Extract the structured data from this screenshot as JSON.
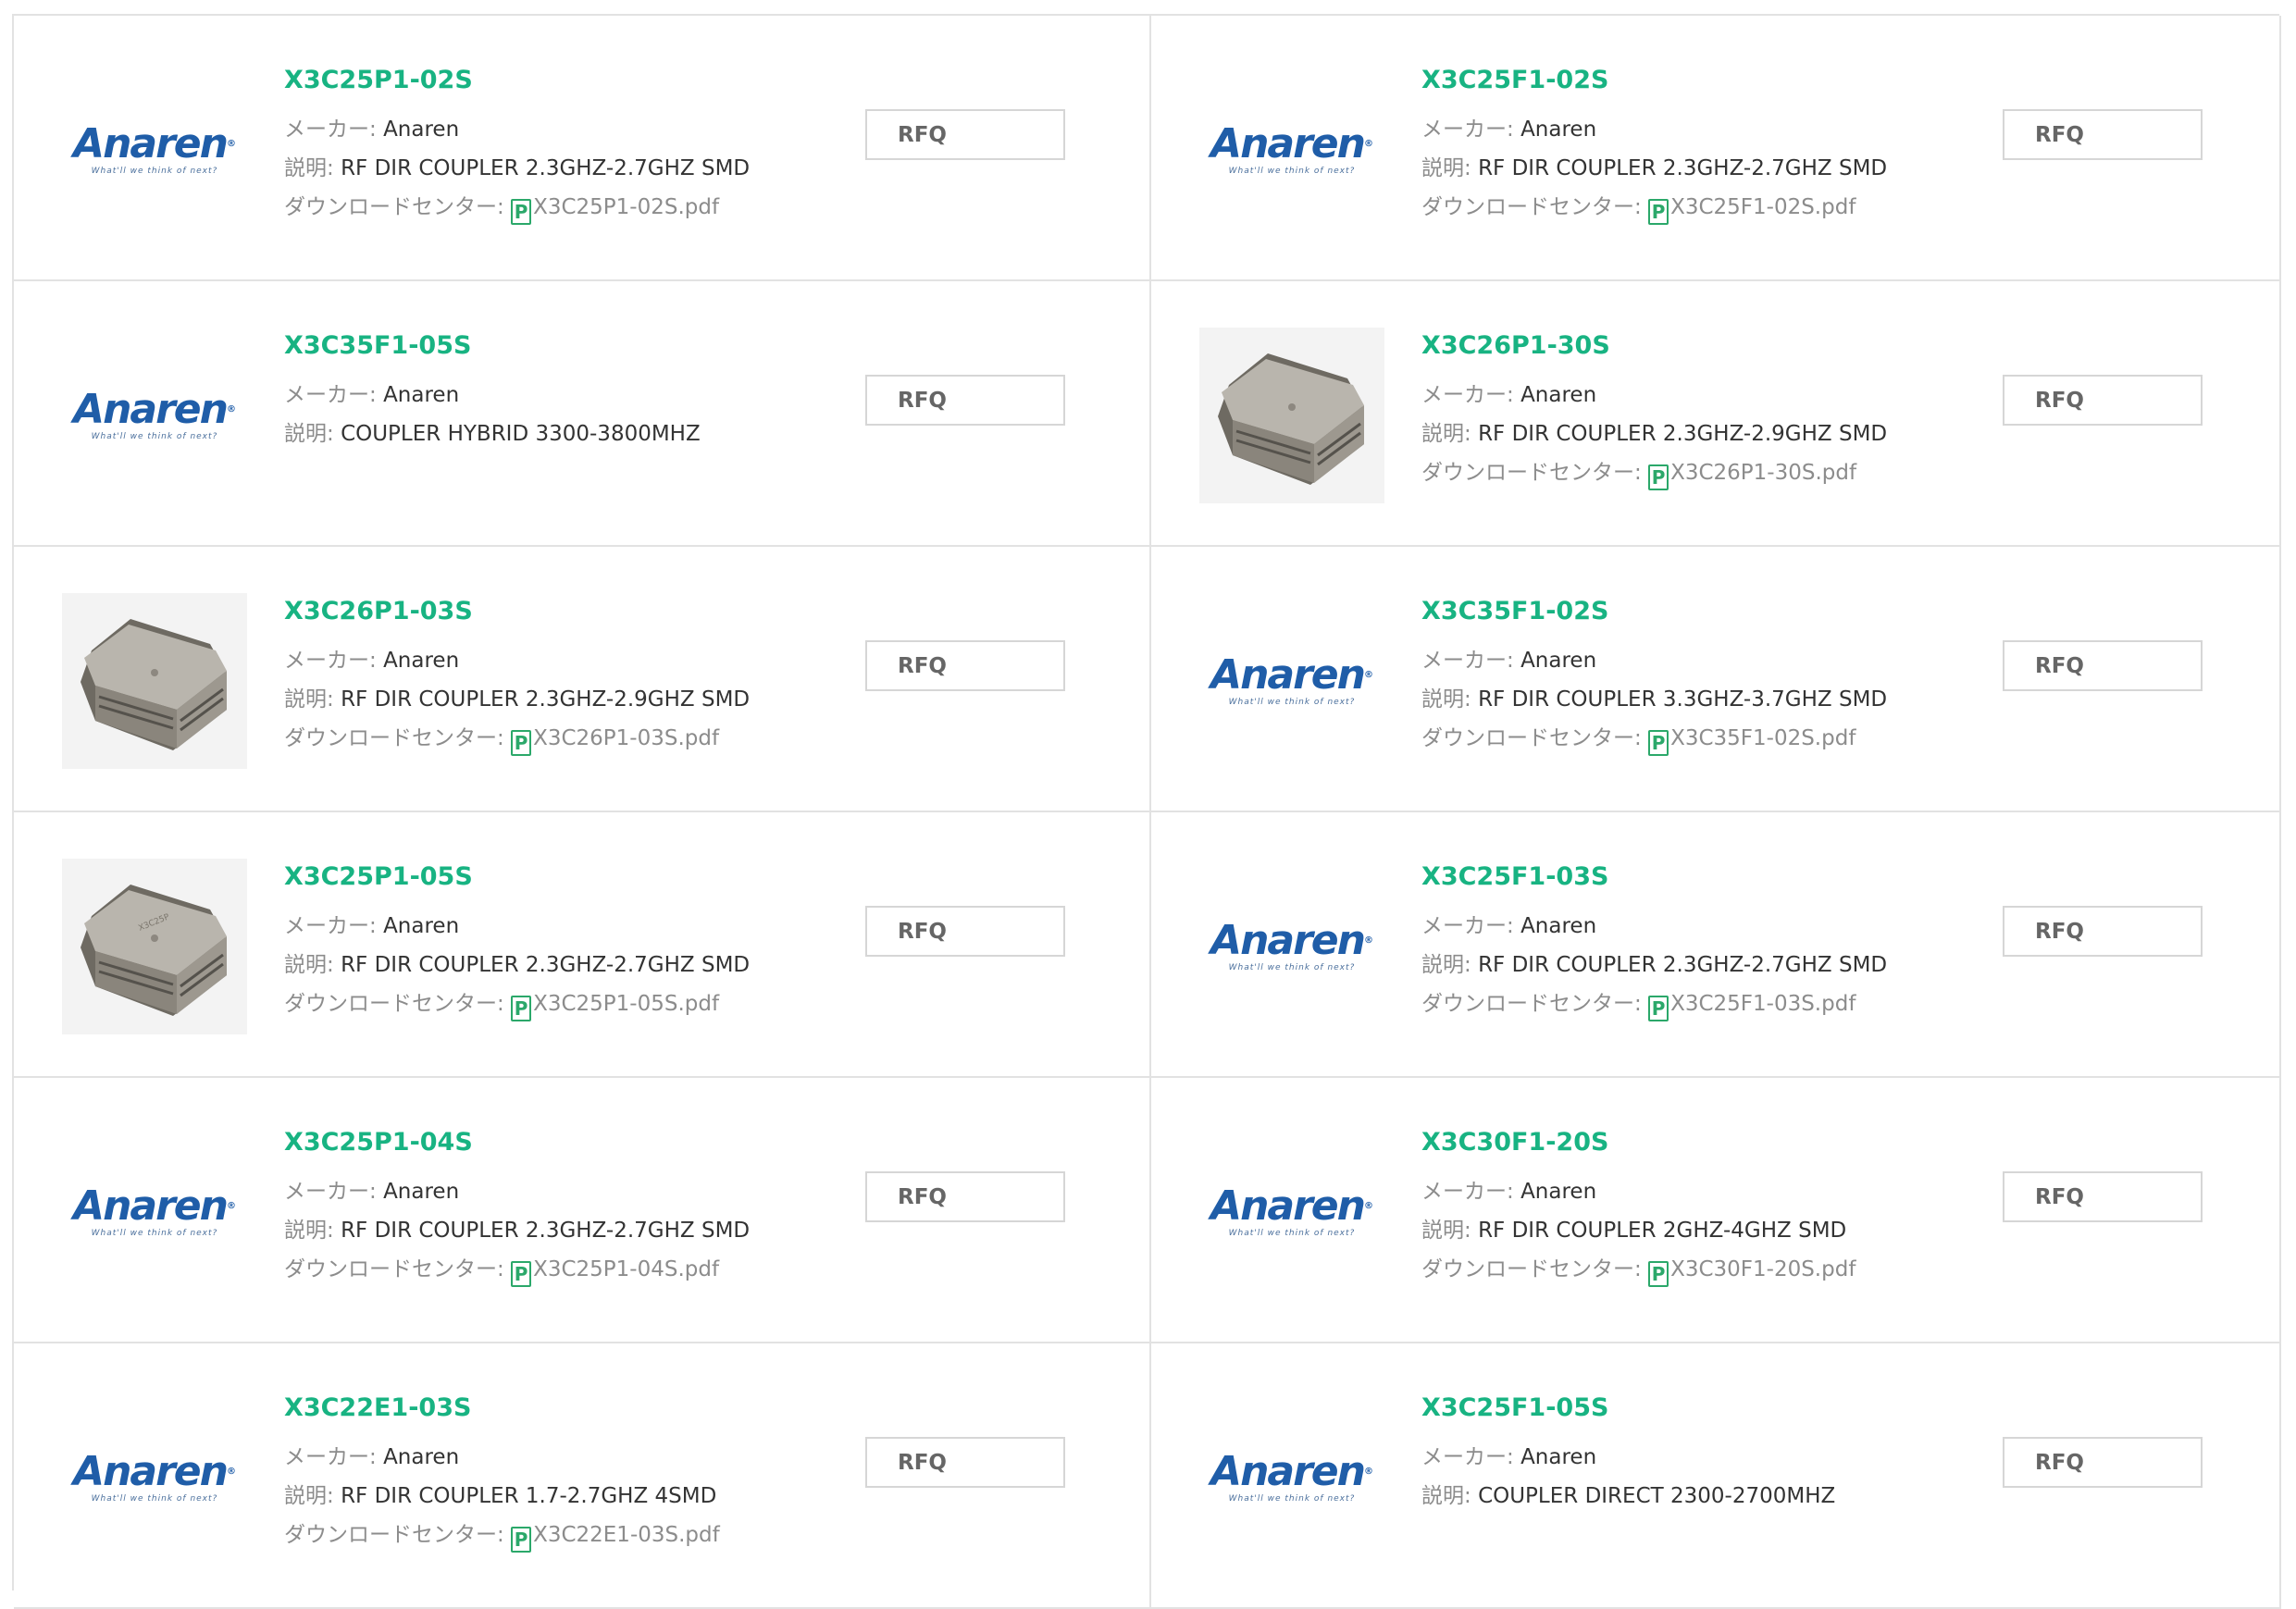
{
  "labels": {
    "maker": "メーカー: ",
    "desc": "説明: ",
    "download": "ダウンロードセンター: ",
    "pdf_glyph": "P",
    "rfq": "RFQ",
    "logo_text": "Anaren",
    "logo_tagline": "What'll we think of next?"
  },
  "products": [
    {
      "pn": "X3C25P1-02S",
      "maker": "Anaren",
      "desc": "RF DIR COUPLER 2.3GHZ-2.7GHZ SMD",
      "file": "X3C25P1-02S.pdf",
      "image": "anaren-logo"
    },
    {
      "pn": "X3C25F1-02S",
      "maker": "Anaren",
      "desc": "RF DIR COUPLER 2.3GHZ-2.7GHZ SMD",
      "file": "X3C25F1-02S.pdf",
      "image": "anaren-logo"
    },
    {
      "pn": "X3C35F1-05S",
      "maker": "Anaren",
      "desc": "COUPLER HYBRID 3300-3800MHZ",
      "file": "",
      "image": "anaren-logo"
    },
    {
      "pn": "X3C26P1-30S",
      "maker": "Anaren",
      "desc": "RF DIR COUPLER 2.3GHZ-2.9GHZ SMD",
      "file": "X3C26P1-30S.pdf",
      "image": "chip-photo"
    },
    {
      "pn": "X3C26P1-03S",
      "maker": "Anaren",
      "desc": "RF DIR COUPLER 2.3GHZ-2.9GHZ SMD",
      "file": "X3C26P1-03S.pdf",
      "image": "chip-photo"
    },
    {
      "pn": "X3C35F1-02S",
      "maker": "Anaren",
      "desc": "RF DIR COUPLER 3.3GHZ-3.7GHZ SMD",
      "file": "X3C35F1-02S.pdf",
      "image": "anaren-logo"
    },
    {
      "pn": "X3C25P1-05S",
      "maker": "Anaren",
      "desc": "RF DIR COUPLER 2.3GHZ-2.7GHZ SMD",
      "file": "X3C25P1-05S.pdf",
      "image": "chip-photo-marked"
    },
    {
      "pn": "X3C25F1-03S",
      "maker": "Anaren",
      "desc": "RF DIR COUPLER 2.3GHZ-2.7GHZ SMD",
      "file": "X3C25F1-03S.pdf",
      "image": "anaren-logo"
    },
    {
      "pn": "X3C25P1-04S",
      "maker": "Anaren",
      "desc": "RF DIR COUPLER 2.3GHZ-2.7GHZ SMD",
      "file": "X3C25P1-04S.pdf",
      "image": "anaren-logo"
    },
    {
      "pn": "X3C30F1-20S",
      "maker": "Anaren",
      "desc": "RF DIR COUPLER 2GHZ-4GHZ SMD",
      "file": "X3C30F1-20S.pdf",
      "image": "anaren-logo"
    },
    {
      "pn": "X3C22E1-03S",
      "maker": "Anaren",
      "desc": "RF DIR COUPLER 1.7-2.7GHZ 4SMD",
      "file": "X3C22E1-03S.pdf",
      "image": "anaren-logo"
    },
    {
      "pn": "X3C25F1-05S",
      "maker": "Anaren",
      "desc": "COUPLER DIRECT 2300-2700MHZ",
      "file": "",
      "image": "anaren-logo"
    }
  ],
  "colors": {
    "part_number": "#18b382",
    "pdf_icon": "#2ba86a",
    "logo": "#1f5da8",
    "border": "#e2e2e2"
  }
}
